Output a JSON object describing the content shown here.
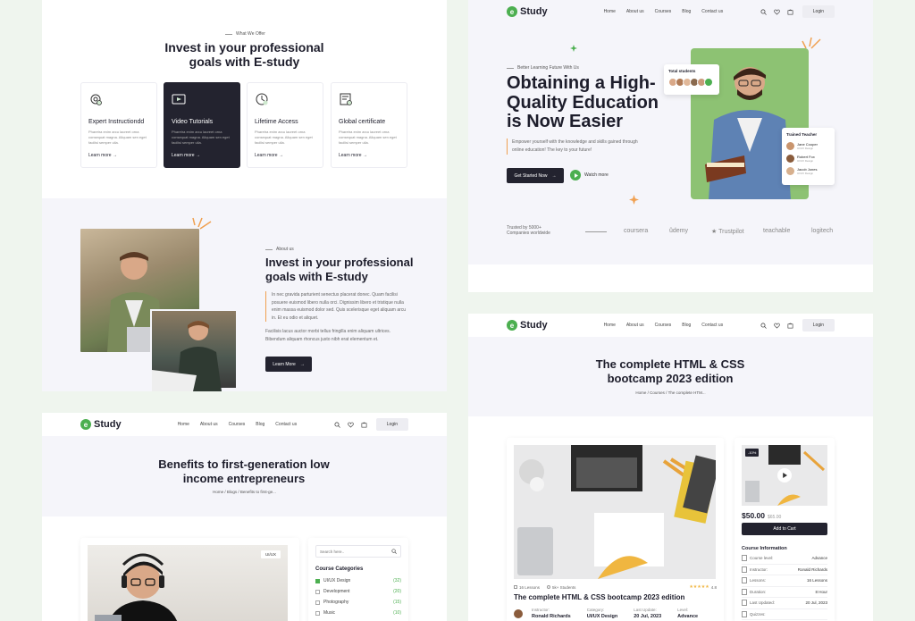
{
  "colors": {
    "accent": "#4caf50",
    "dark": "#23232f",
    "panel_bg": "#f5f5fa",
    "orange": "#f0a050"
  },
  "offer": {
    "eyebrow": "What We Offer",
    "title_l1": "Invest in your professional",
    "title_l2": "goals with E-study",
    "cards": [
      {
        "icon": "gear-people-icon",
        "title": "Expert Instructiondd",
        "desc": "Pharetra enim arcu laoreet orna consequat magna. Aliquam sen eget facilisi semper ulla.",
        "link": "Learn more →"
      },
      {
        "icon": "video-tutorial-icon",
        "title": "Video Tutorials",
        "desc": "Pharetra enim arcu laoreet orna consequat magna. Aliquam sen eget facilisi semper ulla.",
        "link": "Learn more →"
      },
      {
        "icon": "lifetime-access-icon",
        "title": "Lifetime Access",
        "desc": "Pharetra enim arcu laoreet orna consequat magna. Aliquam sen eget facilisi semper ulla.",
        "link": "Learn more →"
      },
      {
        "icon": "certificate-icon",
        "title": "Global certificate",
        "desc": "Pharetra enim arcu laoreet orna consequat magna. Aliquam sen eget facilisi semper ulla.",
        "link": "Learn more →"
      }
    ]
  },
  "about": {
    "eyebrow": "About us",
    "title_l1": "Invest in your professional",
    "title_l2": "goals with E-study",
    "p1": "In nec gravida parturient senectus placerat donec. Quam facilisi posuere euismod libero nulla orci. Dignissim libero et tristique nulla enim massa euismod dolor sed. Quis scelerisque eget aliquam arcu in. Et eu odio et aliquet.",
    "p2": "Facilisis lacus auctor morbi tellus fringilla enim aliquam ultrices. Bibendum aliquam rhoncus justo nibh erat elementum et.",
    "button": "Learn More"
  },
  "nav": {
    "brand": "Study",
    "brand_mark": "e",
    "links": [
      "Home",
      "About us",
      "Courses",
      "Blog",
      "Contact us"
    ],
    "login": "Login"
  },
  "hero": {
    "eyebrow": "Better Learning Future With Us",
    "title_l1": "Obtaining a High-",
    "title_l2": "Quality Education",
    "title_l3": "is Now Easier",
    "desc": "Empower yourself with the knowledge and skills gained through online education! The key to your future!",
    "cta": "Get Started Now",
    "watch": "Watch more",
    "total_students": "Total students",
    "trained_title": "Trained Teacher",
    "teachers": [
      {
        "name": "Jane Cooper",
        "role": "UI/UX Design"
      },
      {
        "name": "Robert Fox",
        "role": "UI/UX Design"
      },
      {
        "name": "Jacob Jones",
        "role": "UI/UX Design"
      }
    ],
    "trusted_l1": "Trusted by 5000+",
    "trusted_l2": "Companies worldwide",
    "partners": [
      "coursera",
      "ûdemy",
      "★ Trustpilot",
      "teachable",
      "logitech"
    ]
  },
  "blog": {
    "title_l1": "Benefits to first-generation low",
    "title_l2": "income entrepreneurs",
    "breadcrumb": "Home / Blogs / Benefits to first-ge...",
    "tag": "UI/UX",
    "search_placeholder": "Search here..",
    "categories_title": "Course Categories",
    "categories": [
      {
        "name": "UI/UX Design",
        "count": "(32)",
        "checked": true
      },
      {
        "name": "Development",
        "count": "(20)",
        "checked": false
      },
      {
        "name": "Photography",
        "count": "(15)",
        "checked": false
      },
      {
        "name": "Music",
        "count": "(10)",
        "checked": false
      }
    ]
  },
  "course": {
    "title_l1": "The complete HTML & CSS",
    "title_l2": "bootcamp 2023 edition",
    "breadcrumb": "Home / Courses / The complete HTM...",
    "lessons": "16 Lessons",
    "students": "5k+ Students",
    "rating": "4.8",
    "card_title": "The complete HTML & CSS bootcamp 2023 edition",
    "meta": [
      {
        "k": "Instructor:",
        "v": "Ronald Richards"
      },
      {
        "k": "Category:",
        "v": "UI/UX Design"
      },
      {
        "k": "Last Update:",
        "v": "20 Jul, 2023"
      },
      {
        "k": "Level:",
        "v": "Advance"
      }
    ],
    "discount": "-10%",
    "price": "$50.00",
    "old_price": "$65.00",
    "add_cart": "Add to Cart",
    "info_title": "Course Information",
    "info": [
      {
        "k": "Course level:",
        "v": "Advance"
      },
      {
        "k": "Instructor:",
        "v": "Ronald Richards"
      },
      {
        "k": "Lessons:",
        "v": "16 Lessons"
      },
      {
        "k": "Duration:",
        "v": "8 Hour"
      },
      {
        "k": "Last Updated:",
        "v": "20 Jul, 2023"
      },
      {
        "k": "Quizzes:",
        "v": ""
      }
    ]
  }
}
